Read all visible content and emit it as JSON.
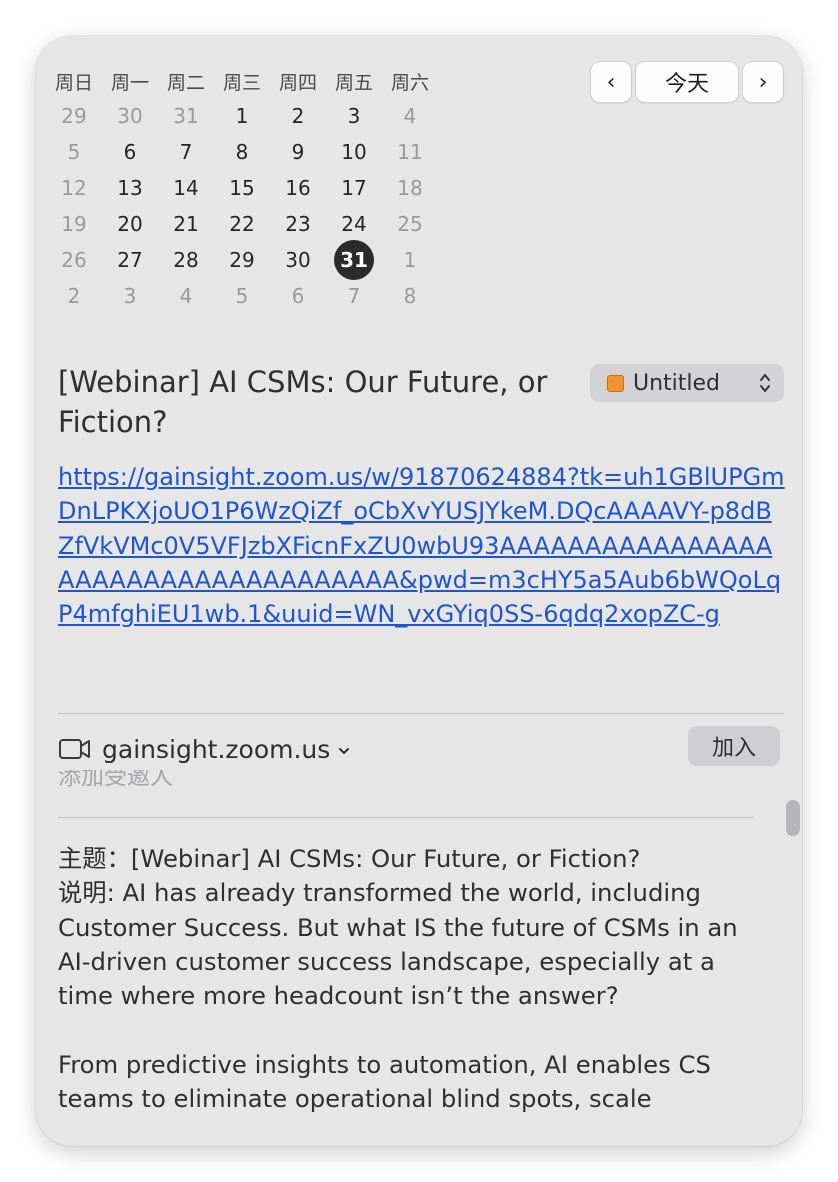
{
  "calendar": {
    "weekdays": [
      "周日",
      "周一",
      "周二",
      "周三",
      "周四",
      "周五",
      "周六"
    ],
    "weeks": [
      [
        {
          "d": "29",
          "dim": true
        },
        {
          "d": "30",
          "dim": true
        },
        {
          "d": "31",
          "dim": true
        },
        {
          "d": "1"
        },
        {
          "d": "2"
        },
        {
          "d": "3"
        },
        {
          "d": "4",
          "dim": true
        }
      ],
      [
        {
          "d": "5",
          "dim": true
        },
        {
          "d": "6"
        },
        {
          "d": "7"
        },
        {
          "d": "8"
        },
        {
          "d": "9"
        },
        {
          "d": "10"
        },
        {
          "d": "11",
          "dim": true
        }
      ],
      [
        {
          "d": "12",
          "dim": true
        },
        {
          "d": "13"
        },
        {
          "d": "14"
        },
        {
          "d": "15"
        },
        {
          "d": "16"
        },
        {
          "d": "17"
        },
        {
          "d": "18",
          "dim": true
        }
      ],
      [
        {
          "d": "19",
          "dim": true
        },
        {
          "d": "20"
        },
        {
          "d": "21"
        },
        {
          "d": "22"
        },
        {
          "d": "23"
        },
        {
          "d": "24"
        },
        {
          "d": "25",
          "dim": true
        }
      ],
      [
        {
          "d": "26",
          "dim": true
        },
        {
          "d": "27"
        },
        {
          "d": "28"
        },
        {
          "d": "29"
        },
        {
          "d": "30"
        },
        {
          "d": "31",
          "selected": true
        },
        {
          "d": "1",
          "dim": true
        }
      ],
      [
        {
          "d": "2",
          "dim": true
        },
        {
          "d": "3",
          "dim": true
        },
        {
          "d": "4",
          "dim": true
        },
        {
          "d": "5",
          "dim": true
        },
        {
          "d": "6",
          "dim": true
        },
        {
          "d": "7",
          "dim": true
        },
        {
          "d": "8",
          "dim": true
        }
      ]
    ]
  },
  "nav": {
    "prev": "‹",
    "today": "今天",
    "next": "›"
  },
  "event": {
    "title": "[Webinar] AI CSMs: Our Future, or Fiction?",
    "calendar_name": "Untitled",
    "calendar_color": "#f2922e",
    "url": "https://gainsight.zoom.us/w/91870624884?tk=uh1GBlUPGmDnLPKXjoUO1P6WzQiZf_oCbXvYUSJYkeM.DQcAAAAVY-p8dBZfVkVMc0V5VFJzbXFicnFxZU0wbU93AAAAAAAAAAAAAAAAAAAAAAAAAAAAAAAAAAAA&pwd=m3cHY5a5Aub6bWQoLqP4mfghiEU1wb.1&uuid=WN_vxGYiq0SS-6qdq2xopZC-g",
    "video_host": "gainsight.zoom.us",
    "join_label": "加入",
    "invitees_placeholder": "添加受邀人",
    "notes": [
      "主题：[Webinar] AI CSMs: Our Future, or Fiction?",
      "说明: AI has already transformed the world, including Customer Success. But what IS the future of CSMs in an AI-driven customer success landscape, especially at a time where more headcount isn’t the answer?",
      "",
      "From predictive insights to automation, AI enables CS teams to eliminate operational blind spots, scale"
    ]
  },
  "icons": {
    "video": "video-camera-icon",
    "chevron": "chevron-down-icon",
    "stepper": "up-down-chevron-icon"
  }
}
